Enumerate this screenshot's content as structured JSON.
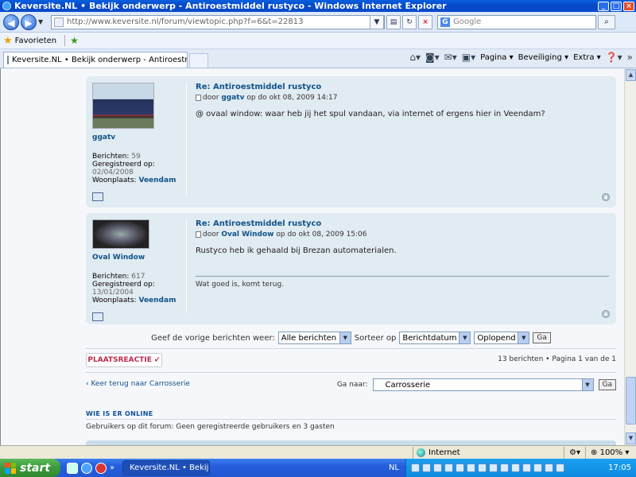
{
  "window": {
    "title": "Keversite.NL • Bekijk onderwerp - Antiroestmiddel rustyco - Windows Internet Explorer",
    "controls": [
      "_",
      "□",
      "×"
    ]
  },
  "addressbar": {
    "url": "http://www.keversite.nl/forum/viewtopic.php?f=6&t=22813",
    "search_placeholder": "Google"
  },
  "favbar": {
    "favorites_label": "Favorieten"
  },
  "tab": {
    "label": "Keversite.NL • Bekijk onderwerp - Antiroestmiddel rusty..."
  },
  "toolbar": {
    "page_label": "Pagina",
    "security_label": "Beveiliging",
    "extra_label": "Extra"
  },
  "posts": [
    {
      "username": "ggatv",
      "posts_label": "Berichten:",
      "posts_count": "59",
      "registered_label": "Geregistreerd op:",
      "registered_date": "02/04/2008",
      "location_label": "Woonplaats:",
      "location": "Veendam",
      "title": "Re: Antiroestmiddel rustyco",
      "by_prefix": "door",
      "author": "ggatv",
      "date_text": "op do okt 08, 2009 14:17",
      "text": "@ ovaal window: waar heb jij het spul vandaan, via internet of ergens hier in Veendam?",
      "signature": ""
    },
    {
      "username": "Oval Window",
      "posts_label": "Berichten:",
      "posts_count": "617",
      "registered_label": "Geregistreerd op:",
      "registered_date": "13/01/2004",
      "location_label": "Woonplaats:",
      "location": "Veendam",
      "title": "Re: Antiroestmiddel rustyco",
      "by_prefix": "door",
      "author": "Oval Window",
      "date_text": "op do okt 08, 2009 15:06",
      "text": "Rustyco heb ik gehaald bij Brezan automaterialen.",
      "signature": "Wat goed is, komt terug."
    }
  ],
  "sortbar": {
    "show_label": "Geef de vorige berichten weer:",
    "show_value": "Alle berichten",
    "sort_label": "Sorteer op",
    "sort_value": "Berichtdatum",
    "order_value": "Oplopend",
    "go_label": "Ga"
  },
  "reply": {
    "label_a": "PLAATS",
    "label_b": "REACTIE",
    "arrow": "↙"
  },
  "pagination": {
    "text": "13 berichten • Pagina 1 van de 1"
  },
  "backlink": {
    "text": "‹ Keer terug naar Carrosserie"
  },
  "jump": {
    "label": "Ga naar:",
    "value": "Carrosserie",
    "go_label": "Ga"
  },
  "whois": {
    "title": "WIE IS ER ONLINE",
    "text": "Gebruikers op dit forum: Geen geregistreerde gebruikers en 3 gasten"
  },
  "statusbar": {
    "zone": "Internet",
    "zoom": "100%"
  },
  "taskbar": {
    "start_label": "start",
    "task_label": "Keversite.NL • Bekij...",
    "lang": "NL",
    "clock": "17:05"
  }
}
